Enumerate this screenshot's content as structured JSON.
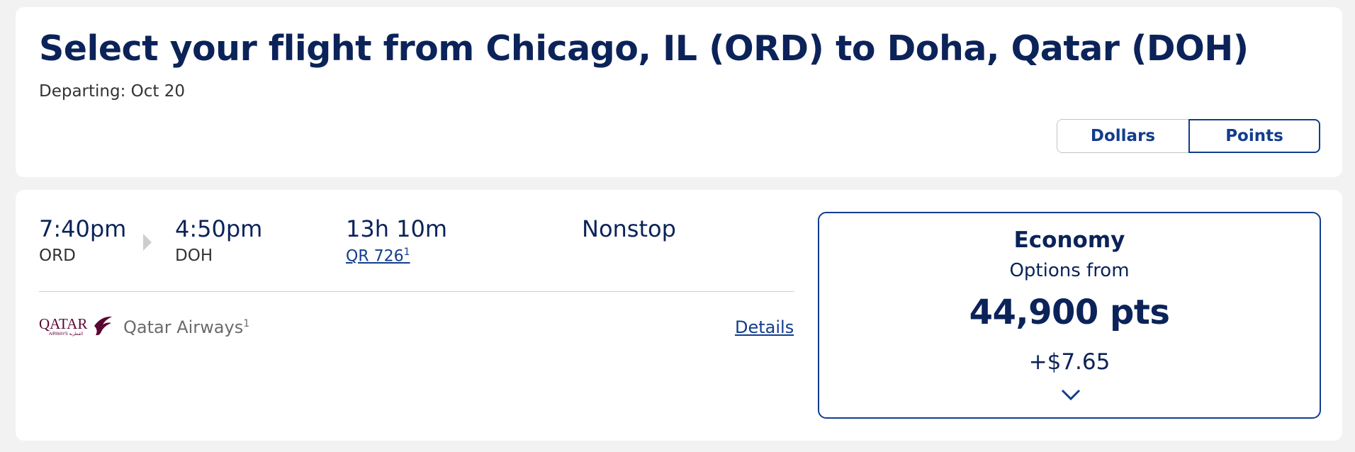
{
  "header": {
    "title": "Select your flight from Chicago, IL (ORD) to Doha, Qatar (DOH)",
    "departing_label": "Departing:",
    "departing_date": "Oct 20",
    "currency_toggle": {
      "dollars": "Dollars",
      "points": "Points",
      "selected": "Points"
    }
  },
  "flight": {
    "depart_time": "7:40pm",
    "depart_code": "ORD",
    "arrive_time": "4:50pm",
    "arrive_code": "DOH",
    "duration": "13h 10m",
    "flight_number": "QR 726",
    "flight_footnote": "1",
    "stops": "Nonstop",
    "airline": {
      "logo_text": "QATAR",
      "logo_subtext": "AIRWAYS القطرية",
      "name": "Qatar Airways",
      "footnote": "1"
    },
    "details_link": "Details",
    "fare": {
      "cabin": "Economy",
      "options_label": "Options from",
      "points": "44,900 pts",
      "fee": "+$7.65"
    }
  },
  "colors": {
    "navy": "#0b2359",
    "link_blue": "#123c8e",
    "qatar_maroon": "#5c0632"
  }
}
